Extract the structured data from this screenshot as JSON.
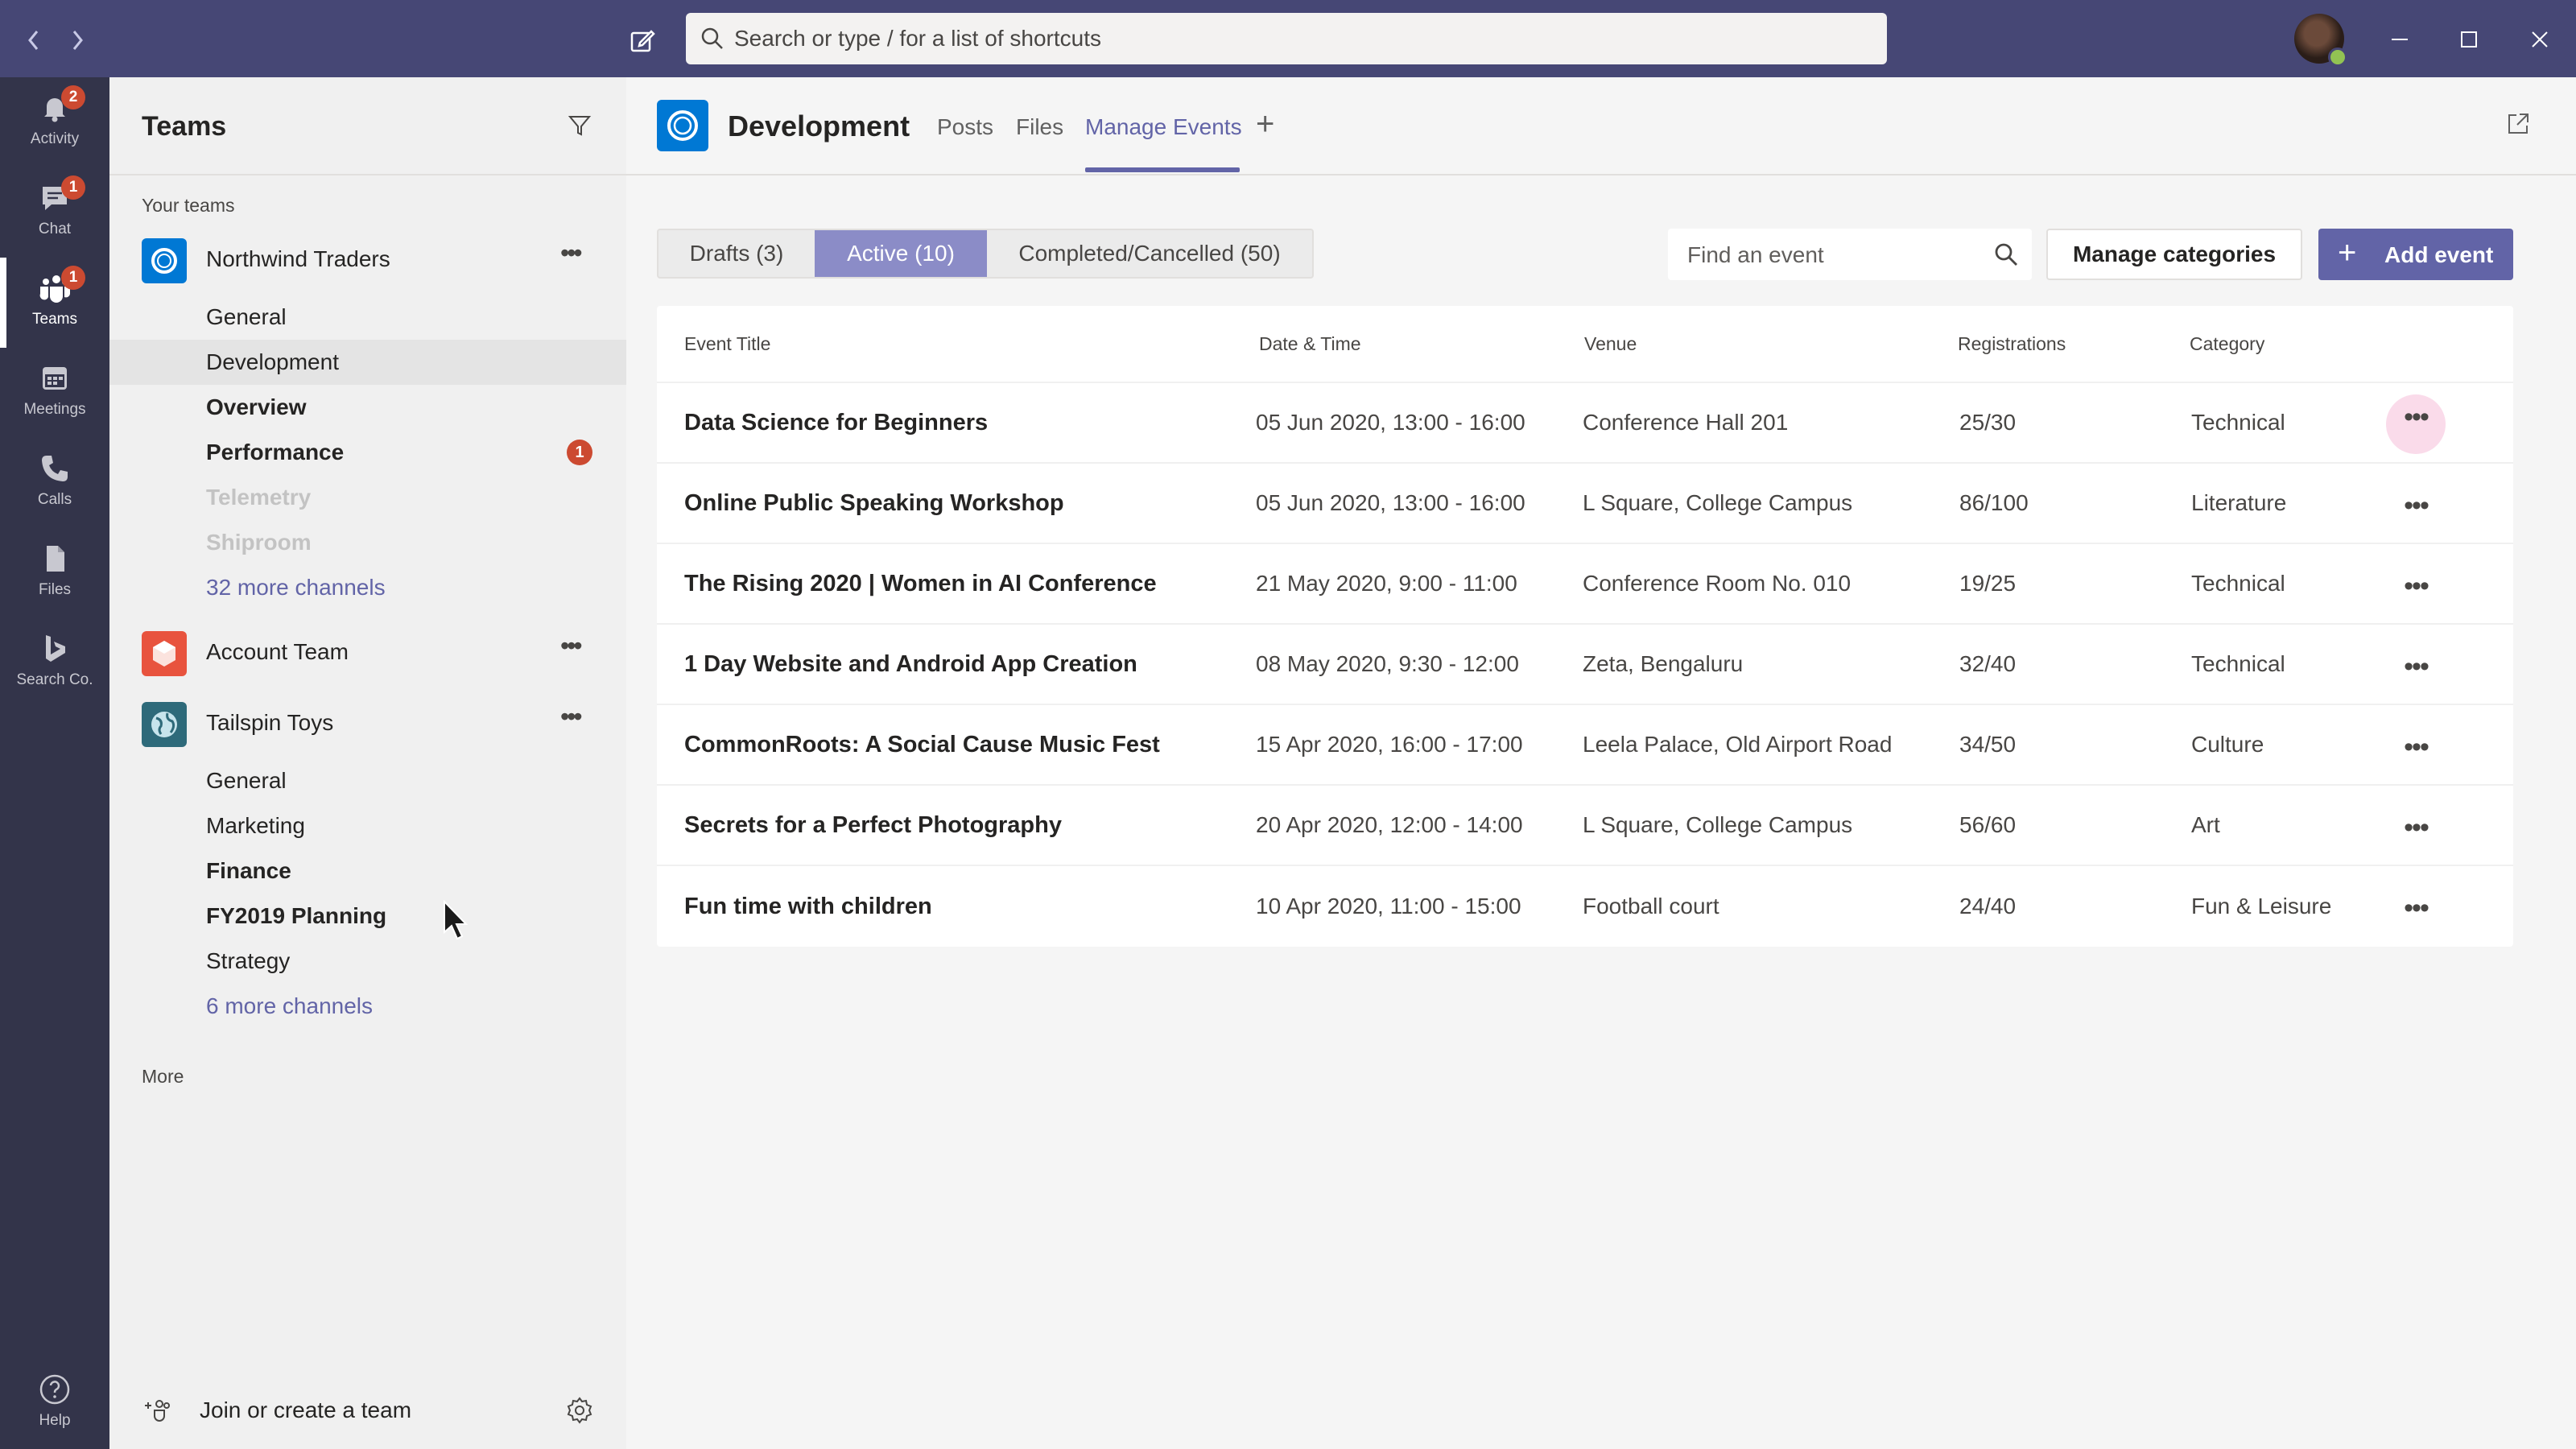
{
  "titlebar": {
    "search_placeholder": "Search or type / for a list of shortcuts",
    "back_icon": "chevron-left-icon",
    "forward_icon": "chevron-right-icon",
    "compose_icon": "compose-icon"
  },
  "rail": {
    "items": [
      {
        "label": "Activity",
        "badge": "2",
        "icon": "bell-icon"
      },
      {
        "label": "Chat",
        "badge": "1",
        "icon": "chat-icon"
      },
      {
        "label": "Teams",
        "badge": "1",
        "icon": "teams-icon"
      },
      {
        "label": "Meetings",
        "badge": "",
        "icon": "calendar-icon"
      },
      {
        "label": "Calls",
        "badge": "",
        "icon": "phone-icon"
      },
      {
        "label": "Files",
        "badge": "",
        "icon": "file-icon"
      },
      {
        "label": "Search Co.",
        "badge": "",
        "icon": "bing-icon"
      }
    ],
    "help_label": "Help"
  },
  "sidebar": {
    "title": "Teams",
    "section_label": "Your teams",
    "teams": [
      {
        "name": "Northwind Traders",
        "color": "#0078d4",
        "channels": [
          {
            "name": "General",
            "style": "normal"
          },
          {
            "name": "Development",
            "style": "selected"
          },
          {
            "name": "Overview",
            "style": "bold"
          },
          {
            "name": "Performance",
            "style": "bold",
            "badge": "1"
          },
          {
            "name": "Telemetry",
            "style": "muted"
          },
          {
            "name": "Shiproom",
            "style": "muted"
          },
          {
            "name": "32 more channels",
            "style": "link"
          }
        ]
      },
      {
        "name": "Account Team",
        "color": "#e8533e",
        "channels": []
      },
      {
        "name": "Tailspin Toys",
        "color": "#2e6a7a",
        "channels": [
          {
            "name": "General",
            "style": "normal"
          },
          {
            "name": "Marketing",
            "style": "normal"
          },
          {
            "name": "Finance",
            "style": "bold"
          },
          {
            "name": "FY2019 Planning",
            "style": "bold"
          },
          {
            "name": "Strategy",
            "style": "normal"
          },
          {
            "name": "6 more channels",
            "style": "link"
          }
        ]
      }
    ],
    "more_label": "More",
    "join_label": "Join or create a team"
  },
  "main": {
    "channel_title": "Development",
    "tabs": [
      "Posts",
      "Files",
      "Manage Events"
    ],
    "active_tab": "Manage Events",
    "filters": {
      "drafts": "Drafts (3)",
      "active": "Active (10)",
      "completed": "Completed/Cancelled (50)"
    },
    "find_placeholder": "Find an event",
    "manage_categories": "Manage categories",
    "add_event": "Add event",
    "columns": [
      "Event Title",
      "Date & Time",
      "Venue",
      "Registrations",
      "Category"
    ],
    "events": [
      {
        "title": "Data Science for Beginners",
        "datetime": "05 Jun 2020, 13:00 - 16:00",
        "venue": "Conference Hall 201",
        "registrations": "25/30",
        "category": "Technical"
      },
      {
        "title": "Online Public Speaking Workshop",
        "datetime": "05 Jun 2020, 13:00 - 16:00",
        "venue": "L Square, College Campus",
        "registrations": "86/100",
        "category": "Literature"
      },
      {
        "title": "The Rising 2020 | Women in AI Conference",
        "datetime": "21 May 2020, 9:00 - 11:00",
        "venue": "Conference Room No. 010",
        "registrations": "19/25",
        "category": "Technical"
      },
      {
        "title": "1 Day Website and Android App Creation",
        "datetime": "08 May 2020, 9:30 - 12:00",
        "venue": "Zeta, Bengaluru",
        "registrations": "32/40",
        "category": "Technical"
      },
      {
        "title": "CommonRoots: A Social Cause Music Fest",
        "datetime": "15 Apr 2020, 16:00 - 17:00",
        "venue": "Leela Palace, Old Airport Road",
        "registrations": "34/50",
        "category": "Culture"
      },
      {
        "title": "Secrets for a Perfect Photography",
        "datetime": "20 Apr 2020, 12:00 - 14:00",
        "venue": "L Square, College Campus",
        "registrations": "56/60",
        "category": "Art"
      },
      {
        "title": "Fun time with children",
        "datetime": "10 Apr 2020, 11:00 - 15:00",
        "venue": "Football court",
        "registrations": "24/40",
        "category": "Fun & Leisure"
      }
    ]
  },
  "colors": {
    "accent": "#6264a7",
    "titlebar": "#464775",
    "rail": "#33344a",
    "badge": "#cc4a31"
  }
}
